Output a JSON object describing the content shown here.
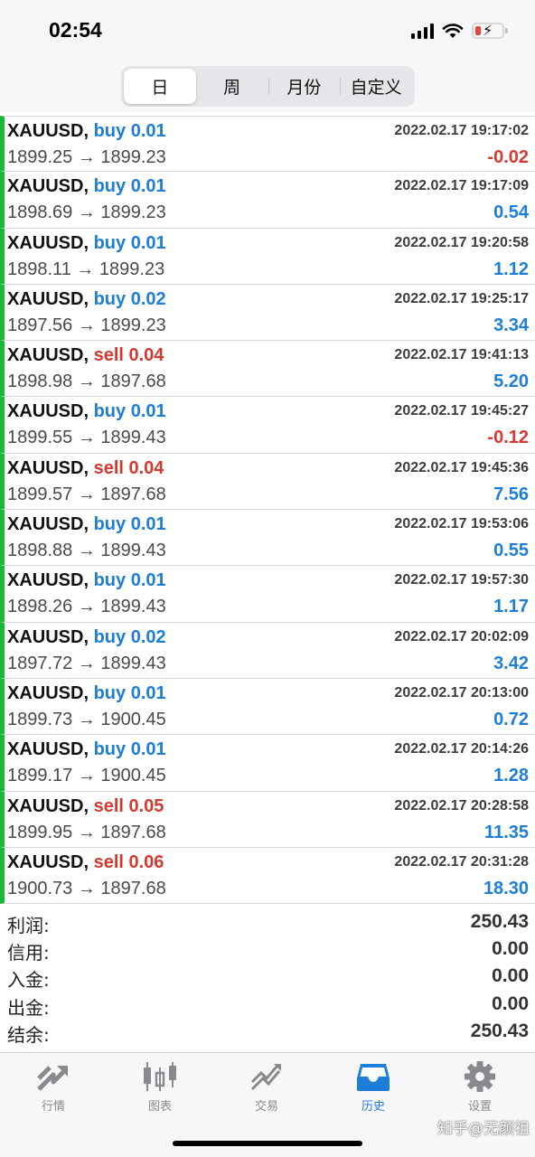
{
  "status_bar": {
    "time": "02:54"
  },
  "period_tabs": [
    {
      "label": "日",
      "active": true
    },
    {
      "label": "周",
      "active": false
    },
    {
      "label": "月份",
      "active": false
    },
    {
      "label": "自定义",
      "active": false
    }
  ],
  "trades": [
    {
      "symbol": "XAUUSD,",
      "side": "buy",
      "lots": "0.01",
      "time": "2022.02.17 19:17:02",
      "prices": "1899.25 → 1899.23",
      "profit": "-0.02"
    },
    {
      "symbol": "XAUUSD,",
      "side": "buy",
      "lots": "0.01",
      "time": "2022.02.17 19:17:09",
      "prices": "1898.69 → 1899.23",
      "profit": "0.54"
    },
    {
      "symbol": "XAUUSD,",
      "side": "buy",
      "lots": "0.01",
      "time": "2022.02.17 19:20:58",
      "prices": "1898.11 → 1899.23",
      "profit": "1.12"
    },
    {
      "symbol": "XAUUSD,",
      "side": "buy",
      "lots": "0.02",
      "time": "2022.02.17 19:25:17",
      "prices": "1897.56 → 1899.23",
      "profit": "3.34"
    },
    {
      "symbol": "XAUUSD,",
      "side": "sell",
      "lots": "0.04",
      "time": "2022.02.17 19:41:13",
      "prices": "1898.98 → 1897.68",
      "profit": "5.20"
    },
    {
      "symbol": "XAUUSD,",
      "side": "buy",
      "lots": "0.01",
      "time": "2022.02.17 19:45:27",
      "prices": "1899.55 → 1899.43",
      "profit": "-0.12"
    },
    {
      "symbol": "XAUUSD,",
      "side": "sell",
      "lots": "0.04",
      "time": "2022.02.17 19:45:36",
      "prices": "1899.57 → 1897.68",
      "profit": "7.56"
    },
    {
      "symbol": "XAUUSD,",
      "side": "buy",
      "lots": "0.01",
      "time": "2022.02.17 19:53:06",
      "prices": "1898.88 → 1899.43",
      "profit": "0.55"
    },
    {
      "symbol": "XAUUSD,",
      "side": "buy",
      "lots": "0.01",
      "time": "2022.02.17 19:57:30",
      "prices": "1898.26 → 1899.43",
      "profit": "1.17"
    },
    {
      "symbol": "XAUUSD,",
      "side": "buy",
      "lots": "0.02",
      "time": "2022.02.17 20:02:09",
      "prices": "1897.72 → 1899.43",
      "profit": "3.42"
    },
    {
      "symbol": "XAUUSD,",
      "side": "buy",
      "lots": "0.01",
      "time": "2022.02.17 20:13:00",
      "prices": "1899.73 → 1900.45",
      "profit": "0.72"
    },
    {
      "symbol": "XAUUSD,",
      "side": "buy",
      "lots": "0.01",
      "time": "2022.02.17 20:14:26",
      "prices": "1899.17 → 1900.45",
      "profit": "1.28"
    },
    {
      "symbol": "XAUUSD,",
      "side": "sell",
      "lots": "0.05",
      "time": "2022.02.17 20:28:58",
      "prices": "1899.95 → 1897.68",
      "profit": "11.35"
    },
    {
      "symbol": "XAUUSD,",
      "side": "sell",
      "lots": "0.06",
      "time": "2022.02.17 20:31:28",
      "prices": "1900.73 → 1897.68",
      "profit": "18.30"
    }
  ],
  "summary": [
    {
      "label": "利润:",
      "value": "250.43"
    },
    {
      "label": "信用:",
      "value": "0.00"
    },
    {
      "label": "入金:",
      "value": "0.00"
    },
    {
      "label": "出金:",
      "value": "0.00"
    },
    {
      "label": "结余:",
      "value": "250.43"
    }
  ],
  "bottom_tabs": [
    {
      "label": "行情",
      "icon": "quotes-arrow-icon",
      "active": false
    },
    {
      "label": "图表",
      "icon": "candlestick-chart-icon",
      "active": false
    },
    {
      "label": "交易",
      "icon": "trade-trend-icon",
      "active": false
    },
    {
      "label": "历史",
      "icon": "history-tray-icon",
      "active": true
    },
    {
      "label": "设置",
      "icon": "gear-icon",
      "active": false
    }
  ],
  "watermark": "知乎@无颜祖",
  "colors": {
    "buy": "#1d7ed8",
    "sell": "#d6392f",
    "profit_positive": "#1d7ed8",
    "profit_negative": "#d6392f",
    "row_marker": "#1db83a",
    "tab_active": "#1d7ed8",
    "tab_inactive": "#8a8a8e"
  }
}
